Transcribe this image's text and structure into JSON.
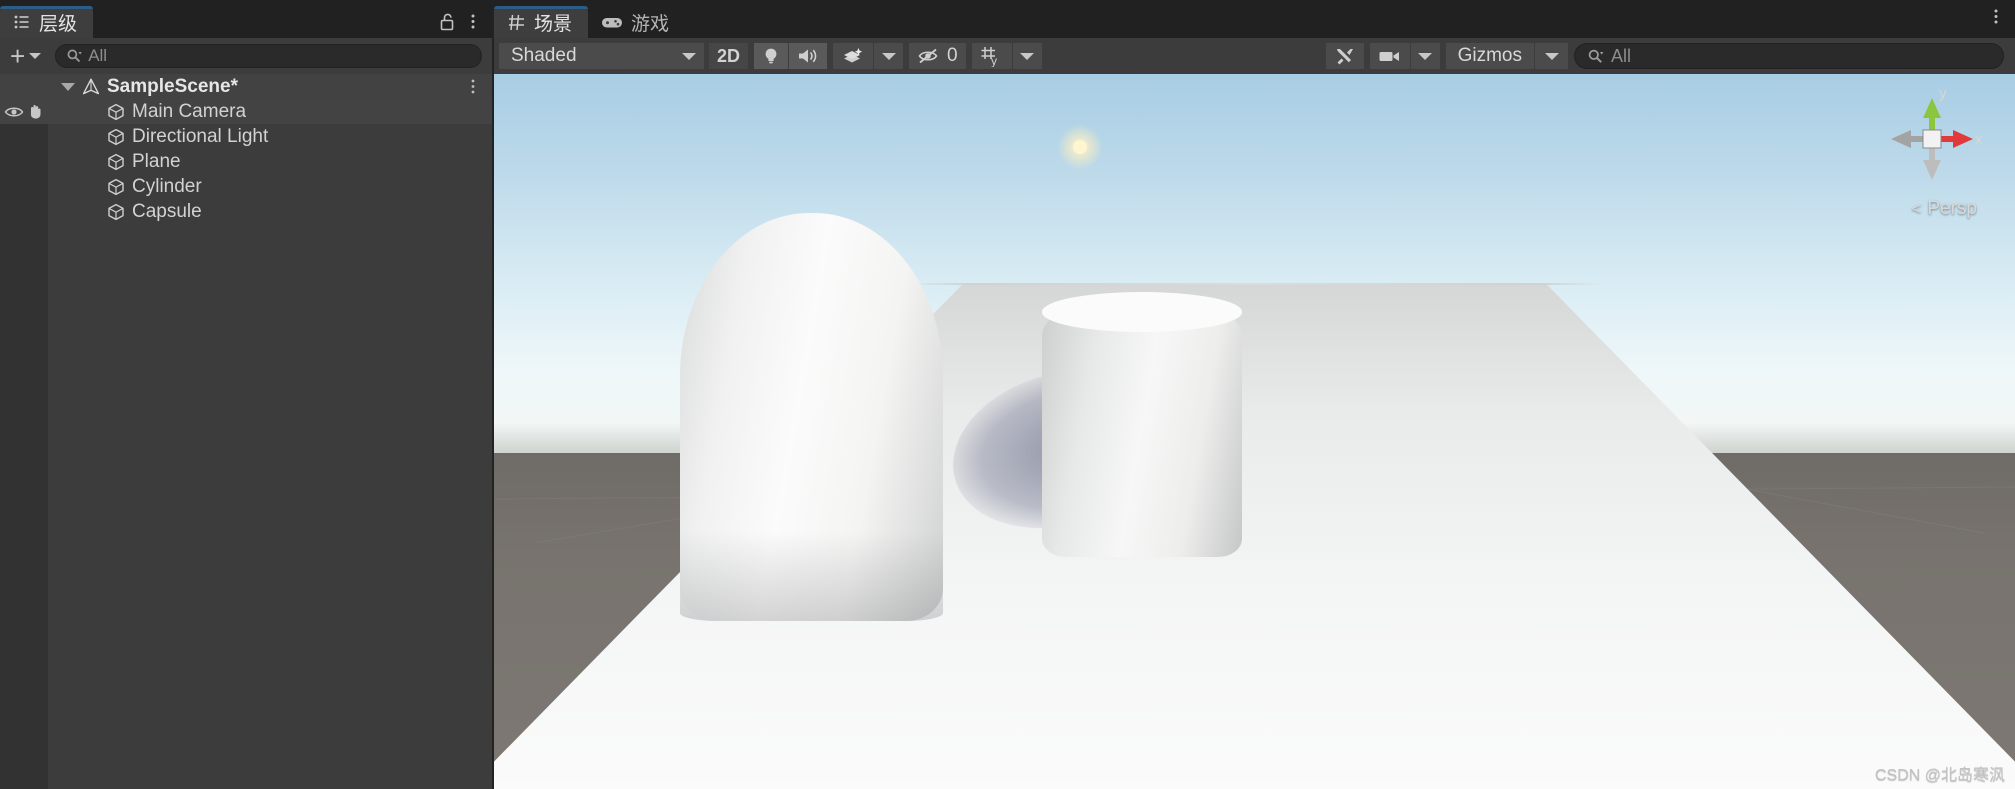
{
  "app": {
    "theme": "unity-dark",
    "accent_blue": "#2c5d87"
  },
  "hierarchy_panel": {
    "tab": {
      "label": "层级",
      "icon": "hierarchy-list-icon"
    },
    "lock_icon": "lock-open-icon",
    "menu_icon": "kebab-menu-icon",
    "toolbar": {
      "create_label": "+",
      "create_dropdown_icon": "chevron-down-icon",
      "search": {
        "placeholder": "All",
        "value": "",
        "icon": "search-icon"
      }
    },
    "tree": [
      {
        "name": "SampleScene*",
        "icon": "unity-scene-icon",
        "depth": 0,
        "expanded": true,
        "selected": false,
        "bold": true
      },
      {
        "name": "Main Camera",
        "icon": "gameobject-cube-icon",
        "depth": 1,
        "hovered": true,
        "visibility_icon": "eye-icon",
        "pickability_icon": "hand-icon"
      },
      {
        "name": "Directional Light",
        "icon": "gameobject-cube-icon",
        "depth": 1
      },
      {
        "name": "Plane",
        "icon": "gameobject-cube-icon",
        "depth": 1
      },
      {
        "name": "Cylinder",
        "icon": "gameobject-cube-icon",
        "depth": 1
      },
      {
        "name": "Capsule",
        "icon": "gameobject-cube-icon",
        "depth": 1
      }
    ]
  },
  "scene_panel": {
    "tabs": [
      {
        "label": "场景",
        "icon": "scene-grid-icon",
        "active": true
      },
      {
        "label": "游戏",
        "icon": "gamepad-icon",
        "active": false
      }
    ],
    "menu_icon": "kebab-menu-icon",
    "toolbar": {
      "draw_mode": {
        "label": "Shaded",
        "icon": "chevron-down-icon"
      },
      "two_d_toggle": {
        "label": "2D",
        "active": false
      },
      "lighting_toggle": {
        "icon": "lightbulb-icon",
        "active": true
      },
      "audio_toggle": {
        "icon": "speaker-icon",
        "active": true
      },
      "effects": {
        "icon": "fx-sparkle-icon",
        "dropdown_icon": "chevron-down-icon"
      },
      "hidden_objects": {
        "icon": "eye-crossed-icon",
        "count": "0"
      },
      "grid": {
        "icon": "grid-y-icon",
        "axis": "y",
        "dropdown_icon": "chevron-down-icon"
      },
      "tools": {
        "icon": "wrench-pencil-icon"
      },
      "camera": {
        "icon": "camera-icon",
        "dropdown_icon": "chevron-down-icon"
      },
      "gizmos": {
        "label": "Gizmos",
        "dropdown_icon": "chevron-down-icon"
      },
      "search": {
        "placeholder": "All",
        "value": "",
        "icon": "search-icon"
      }
    },
    "viewport": {
      "gizmo": {
        "axis_y_label": "y",
        "axis_x_label": "x",
        "axis_y_color": "#8cc63f",
        "axis_x_color": "#e03a3a",
        "axis_z_color": "#9a9a9a",
        "projection_label": "Persp",
        "projection_prefix": "<"
      },
      "objects": [
        {
          "name": "Capsule",
          "shape": "capsule"
        },
        {
          "name": "Cylinder",
          "shape": "cylinder"
        },
        {
          "name": "Plane",
          "shape": "plane"
        },
        {
          "name": "Sun",
          "shape": "sun-flare"
        }
      ],
      "sky_color_top": "#a8cde4",
      "ground_color": "#7a7672"
    },
    "watermark": "CSDN @北岛寒沨"
  }
}
